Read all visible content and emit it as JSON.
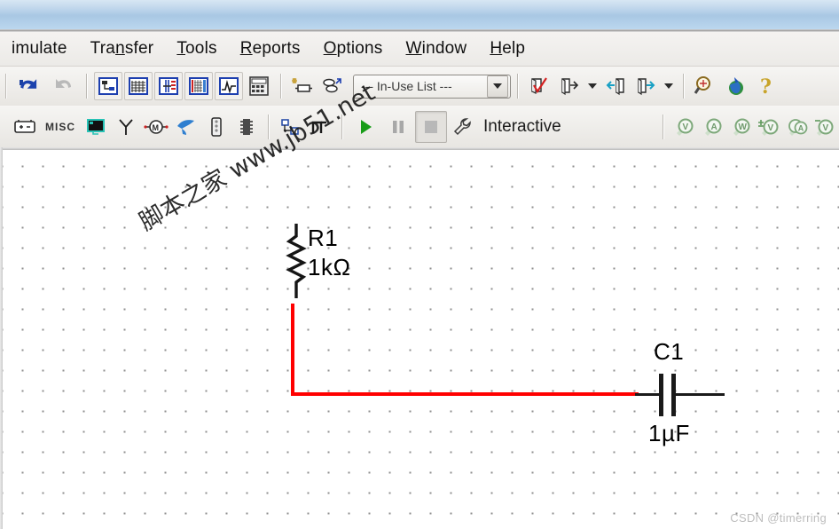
{
  "window": {
    "titlebar_color": "#aecbe6"
  },
  "menubar": {
    "items": [
      {
        "name": "menu-simulate",
        "label": "imulate",
        "underline": ""
      },
      {
        "name": "menu-transfer",
        "label": "Transfer",
        "underline": "n"
      },
      {
        "name": "menu-tools",
        "label": "Tools",
        "underline": "T"
      },
      {
        "name": "menu-reports",
        "label": "Reports",
        "underline": "R"
      },
      {
        "name": "menu-options",
        "label": "Options",
        "underline": "O"
      },
      {
        "name": "menu-window",
        "label": "Window",
        "underline": "W"
      },
      {
        "name": "menu-help",
        "label": "Help",
        "underline": "H"
      }
    ]
  },
  "toolbar_main": {
    "undo_label": "Undo",
    "redo_label": "Redo",
    "icons": [
      {
        "name": "schematic-capture-icon",
        "title": "Schematic Capture"
      },
      {
        "name": "grapher-grid-icon",
        "title": "Grapher"
      },
      {
        "name": "postprocessor-icon",
        "title": "Postprocessor"
      },
      {
        "name": "spreadsheet-view-icon",
        "title": "Spreadsheet View"
      },
      {
        "name": "analysis-waveform-icon",
        "title": "Analyses"
      },
      {
        "name": "calculator-icon",
        "title": "Calculator"
      }
    ],
    "new-component-icon": "New Component",
    "database-manager-icon": "Database Manager",
    "in_use_list": {
      "value": "--- In-Use List ---",
      "placeholder": "--- In-Use List ---"
    },
    "right_icons": [
      {
        "name": "erc-check-icon",
        "title": "Electrical Rules Check"
      },
      {
        "name": "export-netlist-icon",
        "title": "Export"
      },
      {
        "name": "back-annotate-icon",
        "title": "Back Annotate"
      },
      {
        "name": "forward-annotate-icon",
        "title": "Forward Annotate"
      },
      {
        "name": "zoom-search-icon",
        "title": "Find"
      },
      {
        "name": "globe-icon",
        "title": "Education Web Page"
      },
      {
        "name": "help-question-icon",
        "title": "Help"
      }
    ]
  },
  "toolbar_components": {
    "items": [
      {
        "name": "place-source-icon",
        "label": ""
      },
      {
        "name": "place-misc-icon",
        "label": "MISC"
      },
      {
        "name": "place-display-icon",
        "label": ""
      },
      {
        "name": "place-antenna-icon",
        "label": ""
      },
      {
        "name": "place-electromechanical-icon",
        "label": ""
      },
      {
        "name": "place-ni-components-icon",
        "label": ""
      },
      {
        "name": "place-connector-icon",
        "label": ""
      },
      {
        "name": "place-ic-chip-icon",
        "label": ""
      },
      {
        "name": "place-hierarchical-block-icon",
        "label": ""
      },
      {
        "name": "place-bus-icon",
        "label": ""
      }
    ],
    "run_label": "Run",
    "pause_label": "Pause",
    "stop_label": "Stop",
    "simulation_mode": "Interactive",
    "probes": [
      {
        "name": "voltage-probe-icon",
        "letter": "V"
      },
      {
        "name": "current-probe-icon",
        "letter": "A"
      },
      {
        "name": "power-probe-icon",
        "letter": "W"
      },
      {
        "name": "differential-voltage-probe-icon",
        "letter": "V"
      },
      {
        "name": "reference-current-probe-icon",
        "letter": "A"
      },
      {
        "name": "digital-probe-icon",
        "letter": "V"
      }
    ]
  },
  "schematic": {
    "components": [
      {
        "name": "resistor-r1",
        "refdes": "R1",
        "value": "1kΩ",
        "type": "resistor",
        "orientation": "vertical"
      },
      {
        "name": "capacitor-c1",
        "refdes": "C1",
        "value": "1µF",
        "type": "capacitor",
        "orientation": "horizontal"
      }
    ],
    "wires": [
      {
        "name": "net-wire-red",
        "color": "#ff0000",
        "selected": true
      }
    ]
  },
  "watermarks": {
    "diagonal": "脚本之家 www.jb51.net",
    "corner": "CSDN @timerring"
  }
}
